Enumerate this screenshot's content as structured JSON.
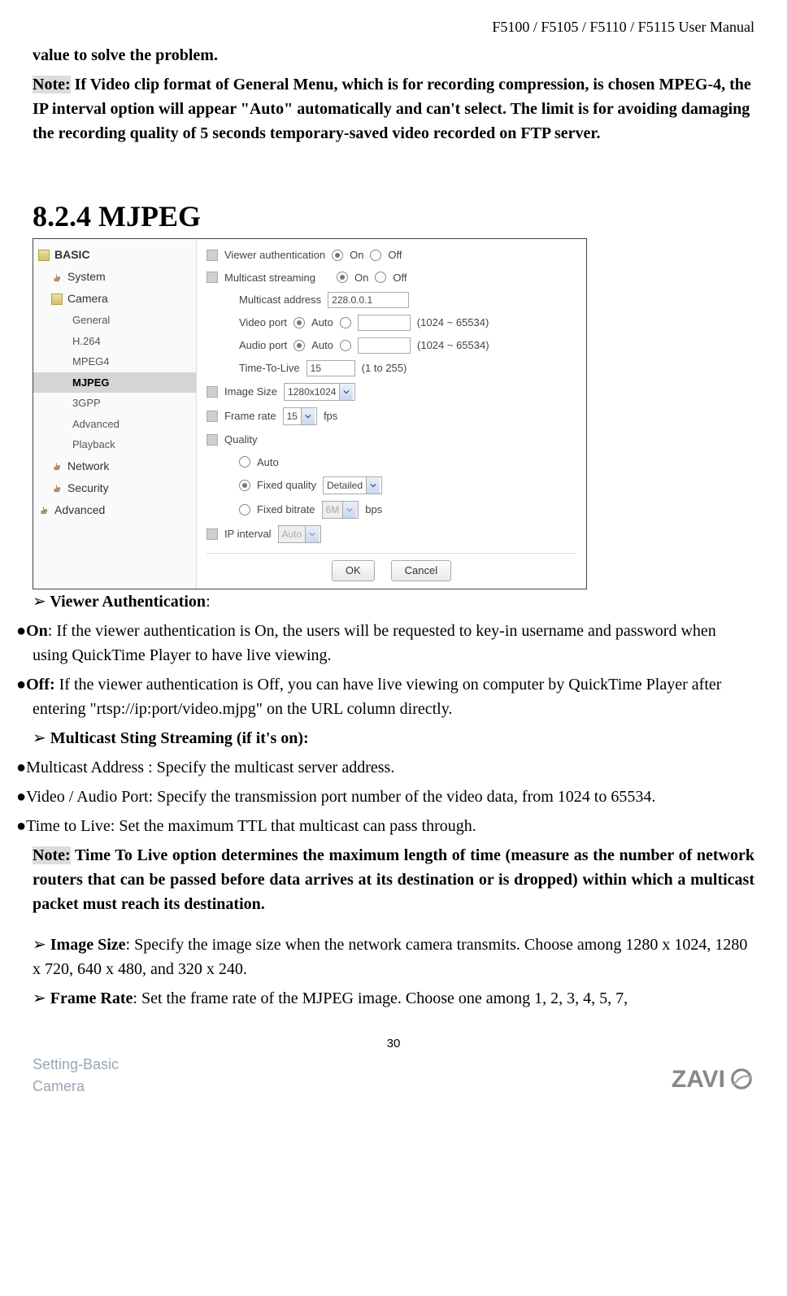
{
  "header": {
    "right": "F5100 / F5105 / F5110 / F5115 User Manual"
  },
  "top_text": {
    "p1": "value to solve the problem.",
    "note_label": "Note:",
    "p2": " If Video clip format of General Menu, which is for recording compression, is chosen MPEG-4, the IP interval option will appear \"Auto\" automatically and can't select. The limit is for avoiding damaging the recording quality of 5 seconds temporary-saved video recorded on FTP server."
  },
  "section": "8.2.4 MJPEG",
  "screenshot": {
    "sidebar": {
      "basic": "BASIC",
      "system": "System",
      "camera": "Camera",
      "camera_items": [
        "General",
        "H.264",
        "MPEG4",
        "MJPEG",
        "3GPP",
        "Advanced",
        "Playback"
      ],
      "network": "Network",
      "security": "Security",
      "advanced": "Advanced"
    },
    "main": {
      "viewer_auth": {
        "label": "Viewer authentication",
        "on": "On",
        "off": "Off"
      },
      "multicast_stream": {
        "label": "Multicast streaming",
        "on": "On",
        "off": "Off"
      },
      "multicast_addr_label": "Multicast address",
      "multicast_addr_val": "228.0.0.1",
      "video_port_label": "Video port",
      "auto": "Auto",
      "range": "(1024 ~ 65534)",
      "audio_port_label": "Audio port",
      "ttl_label": "Time-To-Live",
      "ttl_val": "15",
      "ttl_range": "(1 to 255)",
      "image_size_label": "Image Size",
      "image_size_val": "1280x1024",
      "frame_rate_label": "Frame rate",
      "frame_rate_val": "15",
      "fps": "fps",
      "quality_label": "Quality",
      "q_auto": "Auto",
      "q_fixed_q": "Fixed quality",
      "q_fixed_q_val": "Detailed",
      "q_fixed_b": "Fixed bitrate",
      "q_fixed_b_val": "6M",
      "bps": "bps",
      "ip_interval_label": "IP interval",
      "ip_interval_val": "Auto",
      "ok": "OK",
      "cancel": "Cancel"
    }
  },
  "body": {
    "va_head": " Viewer Authentication",
    "va_on_lbl": "On",
    "va_on_txt": ": If the viewer authentication is On, the users will be requested to key-in username and password when using QuickTime Player to have live viewing.",
    "va_off_lbl": "Off:",
    "va_off_txt": " If the viewer authentication is Off, you can have live viewing on computer by QuickTime Player after entering \"rtsp://ip:port/video.mjpg\" on the URL column directly.",
    "ms_head": " Multicast Sting Streaming (if it's on):",
    "ms_b1": "Multicast Address : Specify the multicast server address.",
    "ms_b2": "Video / Audio Port: Specify the transmission port number of the video data, from 1024 to 65534.",
    "ms_b3": "Time to Live: Set the maximum TTL that multicast can pass through.",
    "ms_note_label": "Note:",
    "ms_note_txt": " Time To Live option determines the maximum length of time (measure as the number of network routers that can be passed before data arrives at its destination or is dropped) within which a multicast packet must reach its destination.",
    "is_head": " Image Size",
    "is_txt": ": Specify the image size when the network camera transmits. Choose among 1280 x 1024, 1280 x 720, 640 x 480, and 320 x 240.",
    "fr_head": " Frame Rate",
    "fr_txt": ": Set the frame rate of the MJPEG image. Choose one among 1, 2, 3, 4, 5, 7,"
  },
  "page_num": "30",
  "footer_left1": "Setting-Basic",
  "footer_left2": "Camera",
  "logo": "ZAVI"
}
